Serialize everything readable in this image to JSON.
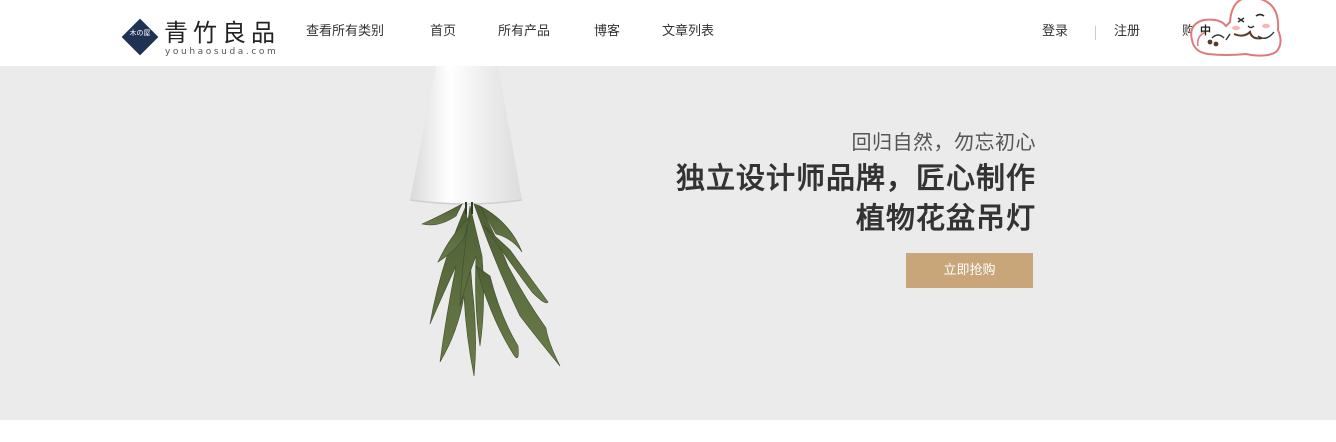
{
  "logo": {
    "name": "青竹良品",
    "subtitle": "youhaosuda.com",
    "seal_text": "木の屋"
  },
  "nav": {
    "items": [
      "查看所有类别",
      "首页",
      "所有产品",
      "博客",
      "文章列表"
    ]
  },
  "account": {
    "login": "登录",
    "register": "注册",
    "cart": "购"
  },
  "mascot": {
    "badge": "中"
  },
  "banner": {
    "tagline": "回归自然，勿忘初心",
    "headline_line1": "独立设计师品牌，匠心制作",
    "headline_line2": "植物花盆吊灯",
    "button": "立即抢购"
  },
  "colors": {
    "banner_bg": "#ebebeb",
    "button_bg": "#c9a57a",
    "logo_navy": "#1f3254"
  }
}
